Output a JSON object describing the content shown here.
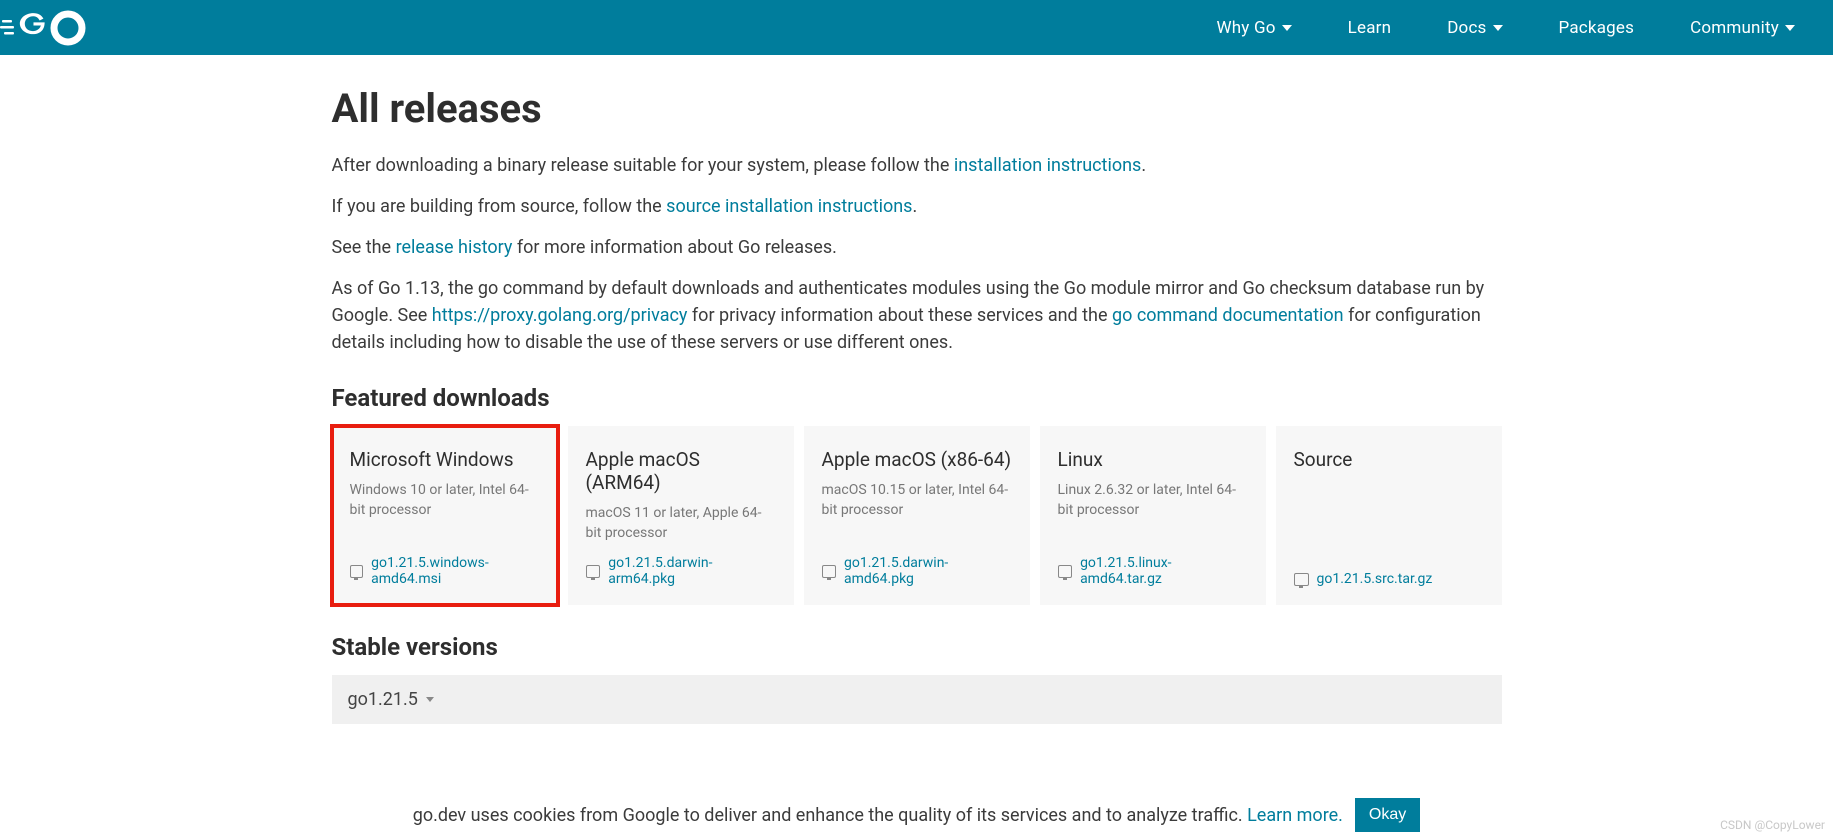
{
  "nav": {
    "items": [
      {
        "label": "Why Go",
        "hasDropdown": true
      },
      {
        "label": "Learn",
        "hasDropdown": false
      },
      {
        "label": "Docs",
        "hasDropdown": true
      },
      {
        "label": "Packages",
        "hasDropdown": false
      },
      {
        "label": "Community",
        "hasDropdown": true
      }
    ]
  },
  "page": {
    "title": "All releases",
    "intro1_pre": "After downloading a binary release suitable for your system, please follow the ",
    "intro1_link": "installation instructions",
    "intro1_post": ".",
    "intro2_pre": "If you are building from source, follow the ",
    "intro2_link": "source installation instructions",
    "intro2_post": ".",
    "intro3_pre": "See the ",
    "intro3_link": "release history",
    "intro3_post": " for more information about Go releases.",
    "intro4a": "As of Go 1.13, the go command by default downloads and authenticates modules using the Go module mirror and Go checksum database run by Google. See ",
    "intro4_link1": "https://proxy.golang.org/privacy",
    "intro4b": " for privacy information about these services and the ",
    "intro4_link2": "go command documentation",
    "intro4c": " for configuration details including how to disable the use of these servers or use different ones."
  },
  "featured": {
    "heading": "Featured downloads",
    "cards": [
      {
        "title": "Microsoft Windows",
        "desc": "Windows 10 or later, Intel 64-bit processor",
        "file": "go1.21.5.windows-amd64.msi",
        "highlighted": true
      },
      {
        "title": "Apple macOS (ARM64)",
        "desc": "macOS 11 or later, Apple 64-bit processor",
        "file": "go1.21.5.darwin-arm64.pkg",
        "highlighted": false
      },
      {
        "title": "Apple macOS (x86-64)",
        "desc": "macOS 10.15 or later, Intel 64-bit processor",
        "file": "go1.21.5.darwin-amd64.pkg",
        "highlighted": false
      },
      {
        "title": "Linux",
        "desc": "Linux 2.6.32 or later, Intel 64-bit processor",
        "file": "go1.21.5.linux-amd64.tar.gz",
        "highlighted": false
      },
      {
        "title": "Source",
        "desc": "",
        "file": "go1.21.5.src.tar.gz",
        "highlighted": false
      }
    ]
  },
  "stable": {
    "heading": "Stable versions",
    "version": "go1.21.5"
  },
  "cookie": {
    "text": "go.dev uses cookies from Google to deliver and enhance the quality of its services and to analyze traffic. ",
    "learn": "Learn more.",
    "ok": "Okay"
  },
  "watermark": "CSDN @CopyLower"
}
